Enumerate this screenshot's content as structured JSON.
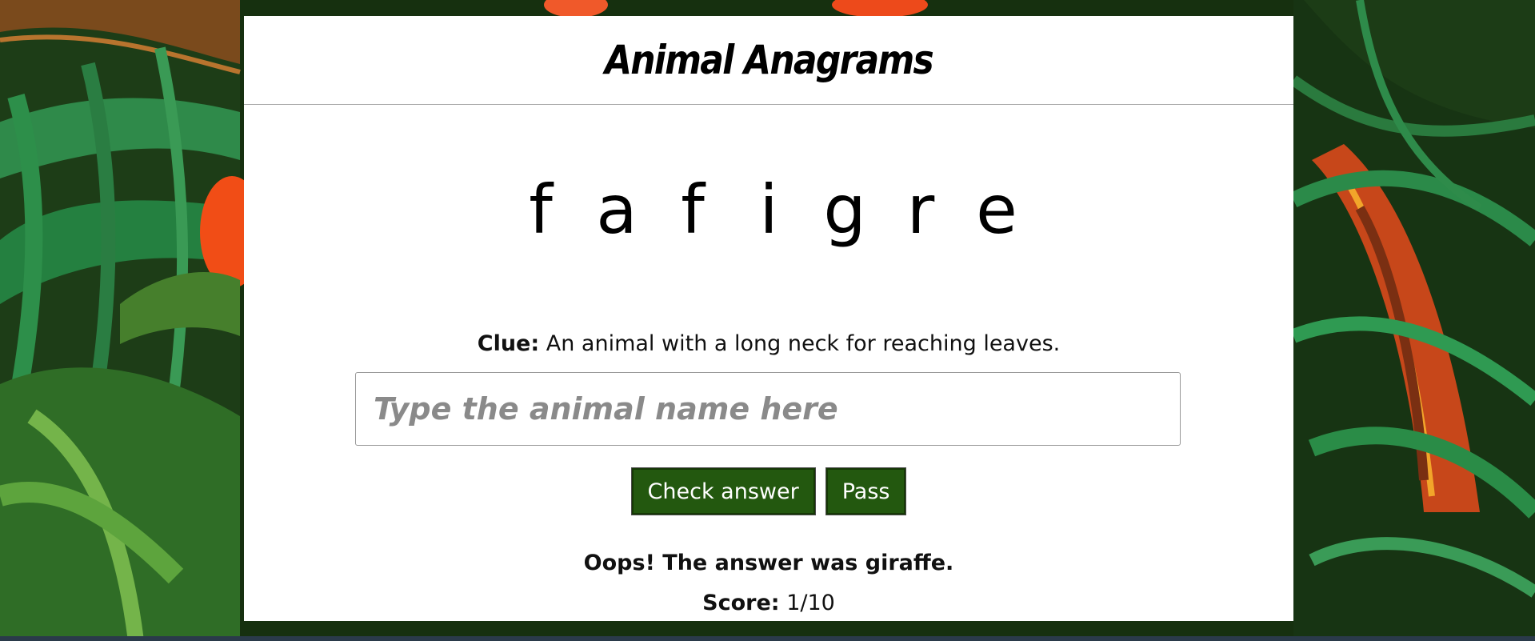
{
  "header": {
    "title": "Animal Anagrams"
  },
  "puzzle": {
    "scrambled_letters": [
      "f",
      "a",
      "f",
      "i",
      "g",
      "r",
      "e"
    ]
  },
  "clue": {
    "label": "Clue:",
    "text": "An animal with a long neck for reaching leaves."
  },
  "answer_input": {
    "value": "",
    "placeholder": "Type the animal name here"
  },
  "buttons": {
    "check_label": "Check answer",
    "pass_label": "Pass"
  },
  "feedback": {
    "message": "Oops! The answer was giraffe."
  },
  "score": {
    "label": "Score:",
    "value": "1/10"
  },
  "colors": {
    "button_bg": "#23580f",
    "card_bg": "#ffffff",
    "jungle_dark": "#1f3a19"
  }
}
